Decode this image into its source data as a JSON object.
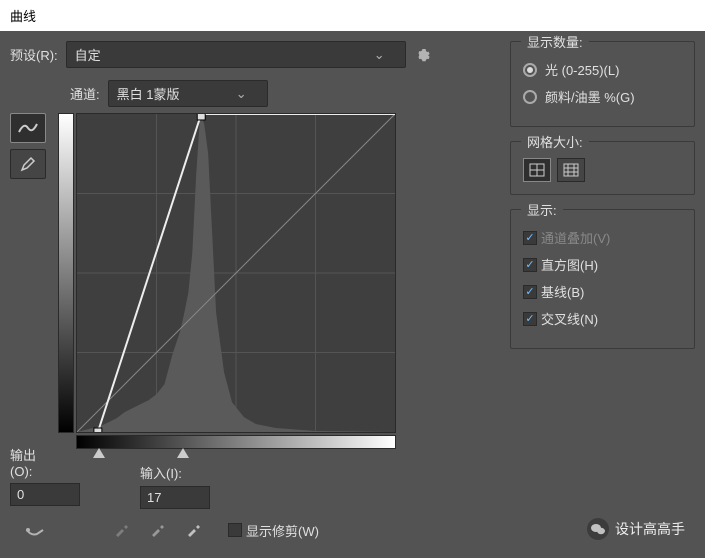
{
  "title": "曲线",
  "preset": {
    "label": "预设(R):",
    "value": "自定"
  },
  "channel": {
    "label": "通道:",
    "value": "黑白 1蒙版"
  },
  "output": {
    "label": "输出(O):",
    "value": "0"
  },
  "input": {
    "label": "输入(I):",
    "value": "17"
  },
  "show_clipping": {
    "label": "显示修剪(W)",
    "checked": false
  },
  "display_amount": {
    "title": "显示数量:",
    "options": [
      {
        "label": "光 (0-255)(L)",
        "selected": true
      },
      {
        "label": "颜料/油墨 %(G)",
        "selected": false
      }
    ]
  },
  "grid_size": {
    "title": "网格大小:"
  },
  "show": {
    "title": "显示:",
    "items": [
      {
        "label": "通道叠加(V)",
        "checked": true,
        "disabled": true
      },
      {
        "label": "直方图(H)",
        "checked": true,
        "disabled": false
      },
      {
        "label": "基线(B)",
        "checked": true,
        "disabled": false
      },
      {
        "label": "交叉线(N)",
        "checked": true,
        "disabled": false
      }
    ]
  },
  "watermark": "设计高高手",
  "chart_data": {
    "type": "line",
    "title": "",
    "xlabel": "输入",
    "ylabel": "输出",
    "xlim": [
      0,
      255
    ],
    "ylim": [
      0,
      255
    ],
    "curve_points": [
      {
        "x": 17,
        "y": 0
      },
      {
        "x": 100,
        "y": 255
      }
    ],
    "baseline": [
      {
        "x": 0,
        "y": 0
      },
      {
        "x": 255,
        "y": 255
      }
    ],
    "histogram_approx": [
      0,
      1,
      2,
      3,
      5,
      8,
      12,
      14,
      16,
      18,
      22,
      28,
      48,
      52,
      60,
      72,
      85,
      110,
      160,
      255,
      240,
      200,
      120,
      70,
      40,
      20,
      12,
      8,
      5,
      4,
      3,
      2,
      1,
      0,
      0,
      0,
      0,
      0,
      0
    ]
  }
}
